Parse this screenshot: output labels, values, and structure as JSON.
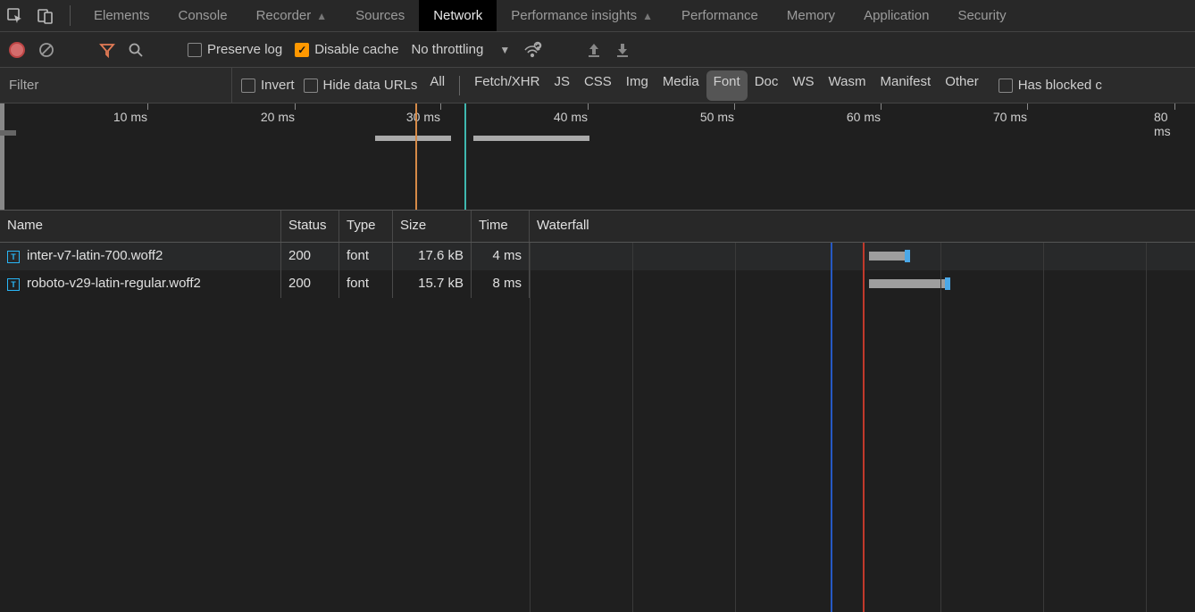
{
  "tabs": {
    "items": [
      "Elements",
      "Console",
      "Recorder",
      "Sources",
      "Network",
      "Performance insights",
      "Performance",
      "Memory",
      "Application",
      "Security"
    ],
    "active": "Network",
    "pinned": [
      "Recorder",
      "Performance insights"
    ]
  },
  "toolbar": {
    "preserve_log": "Preserve log",
    "preserve_log_checked": false,
    "disable_cache": "Disable cache",
    "disable_cache_checked": true,
    "throttling": "No throttling"
  },
  "filterbar": {
    "placeholder": "Filter",
    "invert": "Invert",
    "hide_data_urls": "Hide data URLs",
    "types": [
      "All",
      "Fetch/XHR",
      "JS",
      "CSS",
      "Img",
      "Media",
      "Font",
      "Doc",
      "WS",
      "Wasm",
      "Manifest",
      "Other"
    ],
    "active_type": "Font",
    "has_blocked": "Has blocked c"
  },
  "overview": {
    "labels": [
      "10 ms",
      "20 ms",
      "30 ms",
      "40 ms",
      "50 ms",
      "60 ms",
      "70 ms",
      "80 ms"
    ]
  },
  "columns": {
    "name": "Name",
    "status": "Status",
    "type": "Type",
    "size": "Size",
    "time": "Time",
    "waterfall": "Waterfall"
  },
  "rows": [
    {
      "name": "inter-v7-latin-700.woff2",
      "status": "200",
      "type": "font",
      "size": "17.6 kB",
      "time": "4 ms"
    },
    {
      "name": "roboto-v29-latin-regular.woff2",
      "status": "200",
      "type": "font",
      "size": "15.7 kB",
      "time": "8 ms"
    }
  ]
}
